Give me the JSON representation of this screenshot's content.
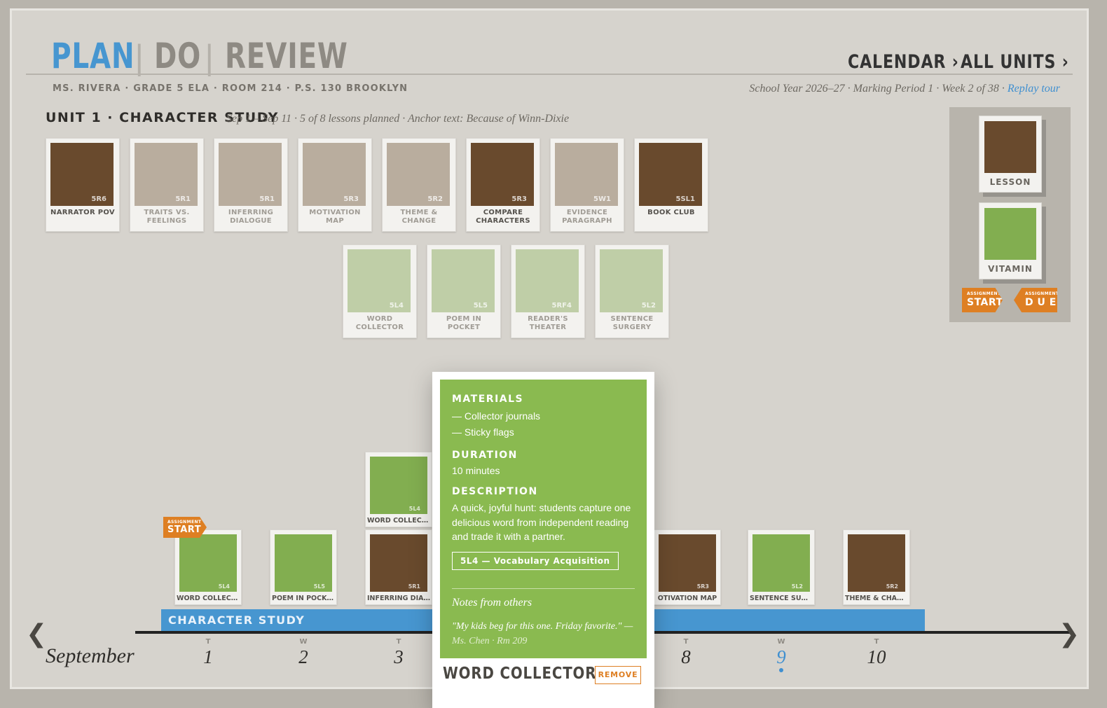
{
  "nav": {
    "plan": "PLAN",
    "do": "DO",
    "review": "REVIEW",
    "sep1": "|",
    "sep2": "|"
  },
  "links": {
    "calendar": "CALENDAR ›",
    "all_units": "ALL UNITS ›"
  },
  "meta": {
    "teacher": "MS. RIVERA · GRADE 5 ELA · ROOM 214 · P.S. 130 BROOKLYN",
    "school_year": "School Year 2026–27 · Marking Period 1 · Week 2 of 38 ·",
    "replay_tour": "Replay tour"
  },
  "unit": {
    "title": "UNIT 1 · CHARACTER STUDY",
    "subtitle": "Sep 1 – Sep 11 · 5 of 8 lessons planned · Anchor text: Because of Winn-Dixie"
  },
  "lessons": [
    {
      "code": "5R6",
      "label": "NARRATOR POV",
      "color": "brown",
      "state": "on"
    },
    {
      "code": "5R1",
      "label": "TRAITS VS. FEELINGS",
      "color": "tan",
      "state": "dim"
    },
    {
      "code": "5R1",
      "label": "INFERRING DIALOGUE",
      "color": "tan",
      "state": "dim"
    },
    {
      "code": "5R3",
      "label": "MOTIVATION MAP",
      "color": "tan",
      "state": "dim"
    },
    {
      "code": "5R2",
      "label": "THEME & CHANGE",
      "color": "tan",
      "state": "dim"
    },
    {
      "code": "5R3",
      "label": "COMPARE CHARACTERS",
      "color": "brown",
      "state": "on"
    },
    {
      "code": "5W1",
      "label": "EVIDENCE PARAGRAPH",
      "color": "tan",
      "state": "dim"
    },
    {
      "code": "5SL1",
      "label": "BOOK CLUB",
      "color": "brown",
      "state": "on"
    }
  ],
  "vitamins": [
    {
      "code": "5L4",
      "label": "WORD COLLECTOR"
    },
    {
      "code": "5L5",
      "label": "POEM IN POCKET"
    },
    {
      "code": "5RF4",
      "label": "READER'S THEATER"
    },
    {
      "code": "5L2",
      "label": "SENTENCE SURGERY"
    }
  ],
  "legend": {
    "lesson": "LESSON",
    "vitamin": "VITAMIN",
    "start_small": "ASSIGNMENT",
    "start_big": "START",
    "due_small": "ASSIGNMENT",
    "due_big": "D U E"
  },
  "timeline": {
    "month": "September",
    "unit_bar": "CHARACTER STUDY",
    "prev": "❮",
    "next": "❯",
    "start_flag_small": "ASSIGNMENT",
    "start_flag_big": "START",
    "days": [
      {
        "dow": "T",
        "num": "1"
      },
      {
        "dow": "W",
        "num": "2"
      },
      {
        "dow": "T",
        "num": "3"
      },
      {
        "dow": "T",
        "num": "8"
      },
      {
        "dow": "W",
        "num": "9",
        "today": true
      },
      {
        "dow": "T",
        "num": "10"
      }
    ],
    "cards": [
      {
        "code": "5L4",
        "label": "WORD COLLECTOR",
        "color": "green"
      },
      {
        "code": "5L5",
        "label": "POEM IN POCKET",
        "color": "green"
      },
      {
        "code": "5L4",
        "label": "WORD COLLECTOR",
        "color": "green"
      },
      {
        "code": "5R1",
        "label": "INFERRING DIALOG…",
        "color": "brown"
      },
      {
        "code": "5R3",
        "label": "OTIVATION MAP",
        "color": "brown"
      },
      {
        "code": "5L2",
        "label": "SENTENCE SURGERY",
        "color": "green"
      },
      {
        "code": "5R2",
        "label": "THEME & CHANGE",
        "color": "brown"
      }
    ]
  },
  "popup": {
    "materials_h": "MATERIALS",
    "materials": [
      "— Collector journals",
      "— Sticky flags"
    ],
    "duration_h": "DURATION",
    "duration": "10 minutes",
    "description_h": "DESCRIPTION",
    "description": "A quick, joyful hunt: students capture one delicious word from independent reading and trade it with a partner.",
    "standard": "5L4 — Vocabulary Acquisition",
    "notes_h": "Notes from others",
    "note": "\"My kids beg for this one. Friday favorite.\" —",
    "note_author": "Ms. Chen · Rm 209",
    "title": "WORD COLLECTOR",
    "remove": "REMOVE"
  },
  "colors": {
    "accent_blue": "#4796d0",
    "orange": "#de7f23",
    "brown": "#694a2d",
    "tan": "#b9ad9e",
    "green": "#82ae50",
    "pale_green": "#bfcea7"
  }
}
